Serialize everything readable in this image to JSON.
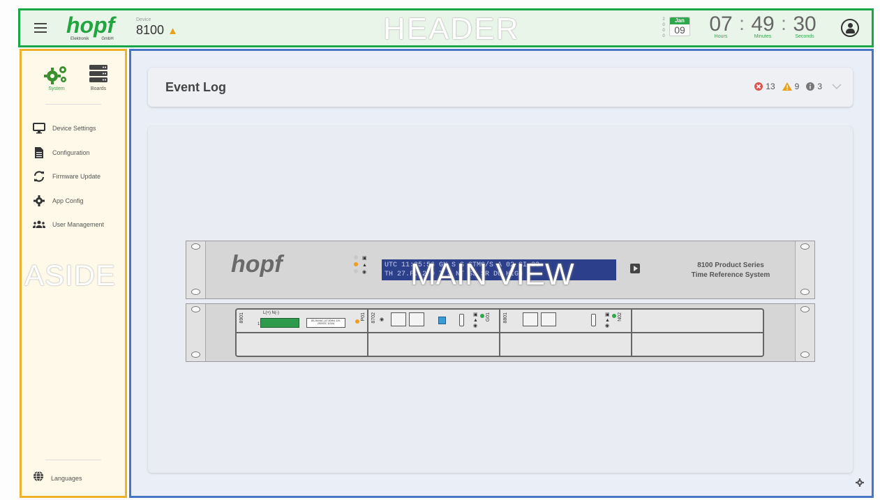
{
  "header": {
    "logo": {
      "word": "hopf",
      "sub_left": "Elektronik",
      "sub_right": "GmbH"
    },
    "device_label": "Device",
    "device_number": "8100",
    "watermark": "HEADER",
    "date": {
      "year": "2000",
      "month": "Jan",
      "day": "09"
    },
    "time": {
      "hours": "07",
      "minutes": "49",
      "seconds": "30",
      "hours_label": "Hours",
      "minutes_label": "Minutes",
      "seconds_label": "Seconds"
    },
    "separator": ":"
  },
  "aside": {
    "tabs": [
      {
        "label": "System",
        "icon": "gears-icon",
        "selected": true
      },
      {
        "label": "Boards",
        "icon": "server-icon",
        "selected": false
      }
    ],
    "menu": [
      {
        "label": "Device Settings",
        "icon": "monitor-icon"
      },
      {
        "label": "Configuration",
        "icon": "document-icon"
      },
      {
        "label": "Firmware Update",
        "icon": "refresh-icon"
      },
      {
        "label": "App Config",
        "icon": "gear-icon"
      },
      {
        "label": "User Management",
        "icon": "users-icon"
      }
    ],
    "watermark": "ASIDE",
    "languages_label": "Languages"
  },
  "main": {
    "event_log": {
      "title": "Event Log",
      "error_count": "13",
      "warning_count": "9",
      "info_count": "3"
    },
    "watermark": "MAIN VIEW",
    "device_view": {
      "logo": "hopf",
      "lcd_line1": "UTC  11:25:56 GN S S STMG/S  A 02  SI 23",
      "lcd_line2": "TH 27.F. 2  0  T  3  NT  SS  SR  DU  HIGH",
      "series_line1": "8100 Product Series",
      "series_line2": "Time Reference System",
      "slots": [
        {
          "id": "8901",
          "side_label": "P01",
          "terminal_label": "L(+) N(-)",
          "spec_label": "85-264VAC (47-63Hz) 120-250VDC 110VA"
        },
        {
          "id": "8702",
          "side_label": "G01"
        },
        {
          "id": "8801",
          "side_label": "N02"
        },
        {
          "id": "",
          "side_label": ""
        }
      ],
      "terminal_marker": "1"
    }
  },
  "colors": {
    "header_bg": "#e9f5e9",
    "header_border": "#18a646",
    "aside_bg": "#fef9e8",
    "aside_border": "#efb02a",
    "main_bg": "#eaeef6",
    "main_border": "#4675c4",
    "accent_green": "#2ea84a",
    "error_red": "#d9534f",
    "warning_orange": "#e7a11c",
    "info_gray": "#777777"
  }
}
